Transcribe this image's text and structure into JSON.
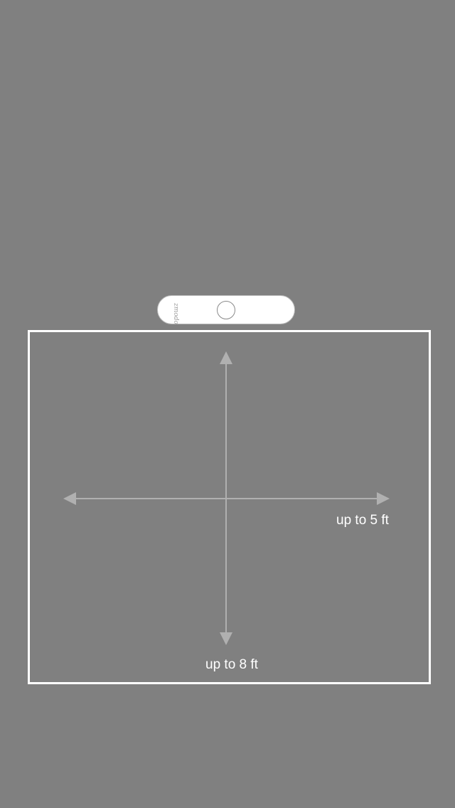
{
  "device": {
    "logo_text": "zmodo"
  },
  "range": {
    "width_label": "up to 5 ft",
    "depth_label": "up to 8 ft"
  },
  "colors": {
    "background": "#808080",
    "frame": "#ffffff",
    "axis": "#b0b0b0",
    "device_body": "#ffffff"
  }
}
